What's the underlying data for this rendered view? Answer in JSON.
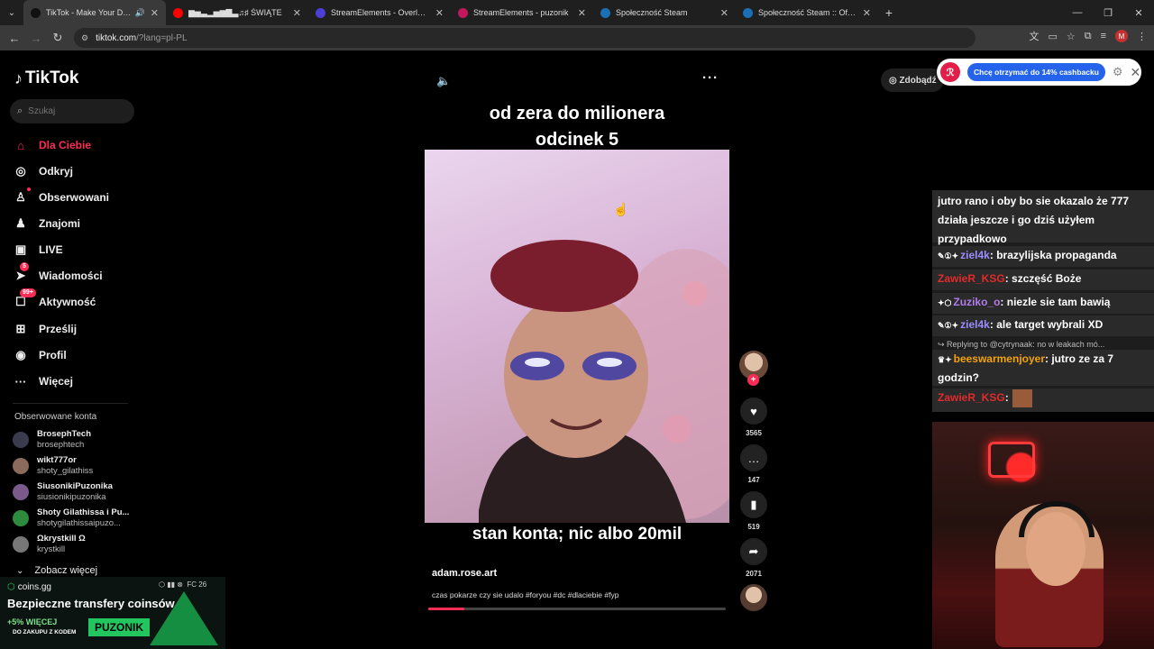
{
  "browser": {
    "tabs": [
      {
        "title": "TikTok - Make Your Day",
        "active": true,
        "fav_color": "#111111",
        "audio": true
      },
      {
        "title": "▆▅▃▂▅▆▇▃♫♯ ŚWIĄTE",
        "active": false,
        "fav_color": "#ff0000",
        "audio": false
      },
      {
        "title": "StreamElements - Overlays",
        "active": false,
        "fav_color": "#4b3fd6",
        "audio": false
      },
      {
        "title": "StreamElements - puzonik",
        "active": false,
        "fav_color": "#c2185b",
        "audio": false
      },
      {
        "title": "Społeczność Steam",
        "active": false,
        "fav_color": "#1b6fb5",
        "audio": false
      },
      {
        "title": "Społeczność Steam :: Oferty wy",
        "active": false,
        "fav_color": "#1b6fb5",
        "audio": false
      }
    ],
    "url_host": "tiktok.com",
    "url_rest": "/?lang=pl-PL",
    "profile_initial": "M"
  },
  "tiktok": {
    "logo": "TikTok",
    "search_placeholder": "Szukaj",
    "nav": [
      {
        "label": "Dla Ciebie",
        "icon": "home-icon",
        "glyph": "⌂",
        "active": true
      },
      {
        "label": "Odkryj",
        "icon": "compass-icon",
        "glyph": "◎",
        "active": false
      },
      {
        "label": "Obserwowani",
        "icon": "following-icon",
        "glyph": "♙",
        "active": false
      },
      {
        "label": "Znajomi",
        "icon": "friends-icon",
        "glyph": "♟",
        "active": false
      },
      {
        "label": "LIVE",
        "icon": "live-icon",
        "glyph": "▣",
        "active": false
      },
      {
        "label": "Wiadomości",
        "icon": "messages-icon",
        "glyph": "➤",
        "active": false,
        "badge": "5"
      },
      {
        "label": "Aktywność",
        "icon": "activity-icon",
        "glyph": "☐",
        "active": false,
        "badge": "99+"
      },
      {
        "label": "Prześlij",
        "icon": "upload-icon",
        "glyph": "⊞",
        "active": false
      },
      {
        "label": "Profil",
        "icon": "profile-icon",
        "glyph": "◉",
        "active": false
      },
      {
        "label": "Więcej",
        "icon": "more-icon",
        "glyph": "···",
        "active": false
      }
    ],
    "following_header": "Obserwowane konta",
    "accounts": [
      {
        "name": "BrosephTech",
        "user": "brosephtech",
        "color": "#3b3b4f"
      },
      {
        "name": "wikt777or",
        "user": "shoty_gilathiss",
        "color": "#8a6a5a"
      },
      {
        "name": "SiusonikiPuzonika",
        "user": "siusionikipuzonika",
        "color": "#7a5a8a"
      },
      {
        "name": "Shoty Gilathissa i Pu...",
        "user": "shotygilathissaipuzo...",
        "color": "#2e8b3e"
      },
      {
        "name": "Ωkrystkill Ω",
        "user": "krystkill",
        "color": "#777777"
      }
    ],
    "see_more": "Zobacz więcej",
    "coins_button": "Zdobądź"
  },
  "video": {
    "caption_line1": "od zera do milionera",
    "caption_line2": "odcinek 5",
    "caption_bottom": "stan konta; nic albo 20mil",
    "author": "adam.rose.art",
    "description": "czas pokarze czy sie udalo #foryou #dc #dlaciebie #fyp",
    "progress_pct": 12,
    "likes": "3565",
    "comments": "147",
    "saves": "519",
    "shares": "2071"
  },
  "extension": {
    "cta": "Chcę otrzymać do 14% cashbacku"
  },
  "ad": {
    "brand": "coins.gg",
    "headline": "Bezpieczne transfery coinsów",
    "promo_line1": "+5% WIĘCEJ",
    "promo_line2": "DO ZAKUPU Z KODEM",
    "code": "PUZONIK",
    "corner": "FC 26"
  },
  "chat": {
    "top_text": "jutro rano i oby bo sie okazalo że 777 działa jeszcze i go dziś użyłem przypadkowo",
    "messages": [
      {
        "user": "ziel4k",
        "text": ": brazylijska propaganda",
        "user_class": "u-green"
      },
      {
        "user": "ZawieR_KSG",
        "text": ": szczęść Boże",
        "user_class": "u-red"
      },
      {
        "user": "Zuziko_o",
        "text": ": niezle sie tam bawią",
        "user_class": "u-purple"
      },
      {
        "user": "ziel4k",
        "text": ": ale target wybrali XD",
        "user_class": "u-green"
      }
    ],
    "reply_to": "Replying to @cytrynaak: no w leakach mó...",
    "reply_user": "beeswarmenjoyer",
    "reply_text": ": jutro ze za 7 godzin?",
    "last_user": "ZawieR_KSG"
  }
}
